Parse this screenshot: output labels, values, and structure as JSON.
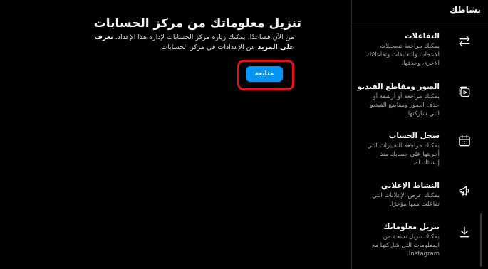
{
  "main": {
    "title": "تنزيل معلوماتك من مركز الحسابات",
    "desc_part1": "من الآن فصاعدًا، يمكنك زيارة مركز الحسابات لإدارة هذا الإعداد. ",
    "desc_bold1": "تعرف على المزيد",
    "desc_part2": " عن الإعدادات في مركز الحسابات.",
    "continue_label": "متابعة"
  },
  "sidebar": {
    "title": "نشاطك",
    "items": [
      {
        "label": "التفاعلات",
        "desc": "يمكنك مراجعة تسجيلات الإعجاب والتعليقات وتفاعلاتك الأخرى وحذفها.",
        "icon": "arrows-swap-icon"
      },
      {
        "label": "الصور ومقاطع الفيديو",
        "desc": "يمكنك مراجعة أو أرشفة أو حذف الصور ومقاطع الفيديو التي شاركتها.",
        "icon": "media-icon"
      },
      {
        "label": "سجل الحساب",
        "desc": "يمكنك مراجعة التغييرات التي أجريتها على حسابك منذ إنشائك له.",
        "icon": "calendar-icon"
      },
      {
        "label": "النشاط الإعلاني",
        "desc": "يمكنك عرض الإعلانات التي تفاعلت معها مؤخرًا.",
        "icon": "megaphone-icon"
      },
      {
        "label": "تنزيل معلوماتك",
        "desc": "يمكنك تنزيل نسخة من المعلومات التي شاركتها مع Instagram.",
        "icon": "download-icon"
      }
    ]
  },
  "colors": {
    "accent": "#0095f6",
    "highlight": "#e3121b",
    "background": "#000000"
  }
}
